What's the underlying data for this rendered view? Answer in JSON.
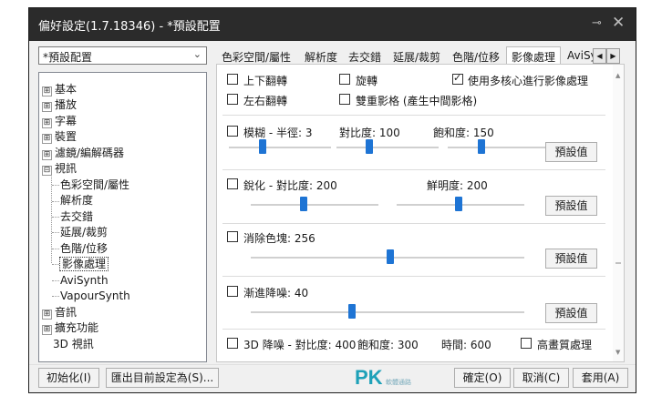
{
  "window": {
    "title": "偏好設定(1.7.18346) - *預設配置",
    "pin_icon": "pin-icon",
    "close_icon": "close-icon"
  },
  "preset": {
    "value": "*預設配置"
  },
  "tree": {
    "items": [
      {
        "label": "基本",
        "expander": "⊞"
      },
      {
        "label": "播放",
        "expander": "⊞"
      },
      {
        "label": "字幕",
        "expander": "⊞"
      },
      {
        "label": "裝置",
        "expander": "⊞"
      },
      {
        "label": "濾鏡/編解碼器",
        "expander": "⊞"
      },
      {
        "label": "視訊",
        "expander": "⊟"
      },
      {
        "label": "色彩空間/屬性"
      },
      {
        "label": "解析度"
      },
      {
        "label": "去交錯"
      },
      {
        "label": "延展/裁剪"
      },
      {
        "label": "色階/位移"
      },
      {
        "label": "影像處理"
      },
      {
        "label": "AviSynth"
      },
      {
        "label": "VapourSynth"
      },
      {
        "label": "音訊",
        "expander": "⊞"
      },
      {
        "label": "擴充功能",
        "expander": "⊞"
      },
      {
        "label": "3D 視訊"
      }
    ]
  },
  "tabs": [
    "色彩空間/屬性",
    "解析度",
    "去交錯",
    "延展/裁剪",
    "色階/位移",
    "影像處理",
    "AviSy"
  ],
  "tab_nav": {
    "prev": "◀",
    "next": "▶"
  },
  "options": {
    "flip_vertical": {
      "label": "上下翻轉",
      "checked": false
    },
    "rotate": {
      "label": "旋轉",
      "checked": false
    },
    "multicore": {
      "label": "使用多核心進行影像處理",
      "checked": true
    },
    "flip_horizontal": {
      "label": "左右翻轉",
      "checked": false
    },
    "double_image": {
      "label": "雙重影格 (產生中間影格)",
      "checked": false
    }
  },
  "blur": {
    "label": "模糊 - 半徑: 3",
    "contrast_label": "對比度: 100",
    "saturation_label": "飽和度: 150",
    "radius_level": 0.25,
    "contrast_level": 0.5,
    "saturation_level": 0.5,
    "checked": false
  },
  "sharpen": {
    "label": "銳化 - 對比度: 200",
    "sharpness_label": "鮮明度: 200",
    "contrast_level": 0.5,
    "sharpness_level": 0.5,
    "checked": false
  },
  "deblock": {
    "label": "消除色塊: 256",
    "level": 0.5,
    "checked": false
  },
  "denoise": {
    "label": "漸進降噪: 40",
    "level": 0.4,
    "checked": false
  },
  "denoise3d": {
    "label": "3D 降噪 - 對比度: 400",
    "saturation_label": "飽和度: 300",
    "time_label": "時間: 600",
    "hq_label": "高畫質處理",
    "checked": false,
    "hq_checked": false
  },
  "default_button": "預設值",
  "footer": {
    "init": "初始化(I)",
    "export": "匯出目前設定為(S)...",
    "ok": "確定(O)",
    "cancel": "取消(C)",
    "apply": "套用(A)"
  },
  "watermark": {
    "text": "PK",
    "sub": "軟體通路"
  }
}
